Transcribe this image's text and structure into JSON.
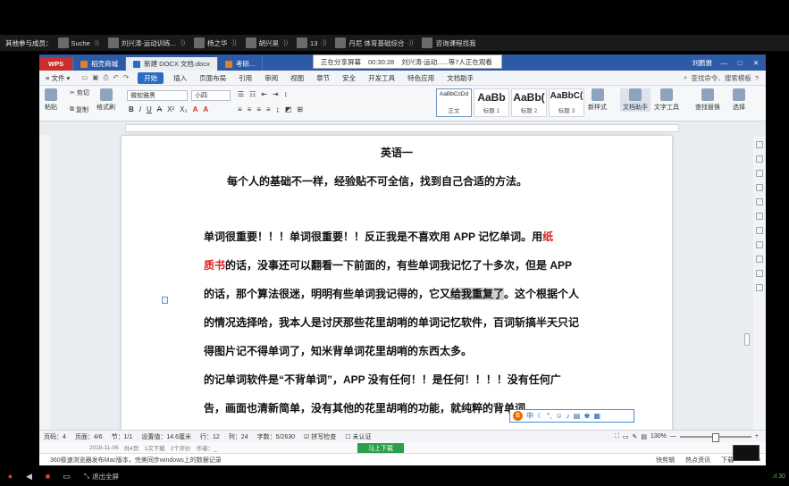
{
  "participants_bar": {
    "lead": "其他参与成员：",
    "people": [
      {
        "name": "Suche"
      },
      {
        "name": "刘兴涛-运动训练..."
      },
      {
        "name": "杨之华"
      },
      {
        "name": "胡兴昊"
      },
      {
        "name": "13"
      },
      {
        "name": "丹尼 体育基础综合"
      },
      {
        "name": "咨询课程找我"
      }
    ]
  },
  "wps": {
    "tabs": [
      {
        "label": "WPS"
      },
      {
        "label": "稻壳商城"
      },
      {
        "label": "新建 DOCX 文档.docx"
      },
      {
        "label": "考研..."
      }
    ],
    "share": {
      "status": "正在分享屏幕",
      "time": "00:30:28",
      "viewers": "刘兴涛-运动......等7人正在观看"
    },
    "account": "刘鹏雅",
    "menu": {
      "file": "文件",
      "items": [
        "开始",
        "插入",
        "页面布局",
        "引用",
        "审阅",
        "视图",
        "章节",
        "安全",
        "开发工具",
        "特色应用",
        "文档助手"
      ],
      "search": "查找命令、搜索模板"
    },
    "ribbon": {
      "paste": "粘贴",
      "cut": "剪切",
      "copy": "复制",
      "format_painter": "格式刷",
      "font_name": "微软雅黑",
      "font_size": "小四",
      "styles": [
        {
          "preview": "AaBbCcDd",
          "label": "正文"
        },
        {
          "preview": "AaBb",
          "label": "标题 1"
        },
        {
          "preview": "AaBb(",
          "label": "标题 2"
        },
        {
          "preview": "AaBbC(",
          "label": "标题 3"
        }
      ],
      "new_style": "新样式",
      "doc_assistant": "文档助手",
      "text_tool": "文字工具",
      "find_replace": "查找替换",
      "select": "选择"
    },
    "document": {
      "title": "英语一",
      "subtitle": "每个人的基础不一样，经验贴不可全信，找到自己合适的方法。",
      "lines": [
        {
          "pre": "单词很重要！！！单词很重要！！反正我是不喜欢用 APP 记忆单词。用",
          "red": "纸"
        },
        {
          "red": "质书",
          "post": "的话，没事还可以翻看一下前面的，有些单词我记忆了十多次，但是 APP"
        },
        {
          "pre": "的话，那个算法很迷，明明有些单词我记得的，它又",
          "hl": "给我重复了",
          "post": "。这个根据个人"
        },
        {
          "text": "的情况选择哈，我本人是讨厌那些花里胡哨的单词记忆软件，百词斩搞半天只记"
        },
        {
          "text": "得图片记不得单词了，知米背单词花里胡哨的东西太多。"
        },
        {
          "text": "的记单词软件是“不背单词”，APP 没有任何！！是任何！！！！没有任何广"
        },
        {
          "text": "告，画面也清新简单，没有其他的花里胡哨的功能，就纯粹的背单词。"
        }
      ]
    },
    "ime": {
      "label": "中"
    },
    "status": {
      "page_num": "页码：4",
      "page_of": "页面：4/6",
      "section": "节：1/1",
      "setting": "设置值：14.6厘米",
      "row": "行：12",
      "col": "列：24",
      "words": "字数：5/2630",
      "spellcheck": "拼写检查",
      "auth": "未认证",
      "zoom": "130%"
    },
    "infobar": {
      "date": "2018-11-06",
      "total": "共4页",
      "downloads": "1次下载",
      "other": "2个评价",
      "author": "作者：_",
      "download_btn": "马上下载"
    },
    "newsbar": {
      "news": "360极速浏览器发布Mac版本，完美同步windows上的数据记录",
      "items": [
        "快剪辑",
        "热点资讯",
        "下载",
        "100%"
      ]
    }
  },
  "controls": {
    "exit_fullscreen": "退出全屏",
    "net": "30"
  }
}
